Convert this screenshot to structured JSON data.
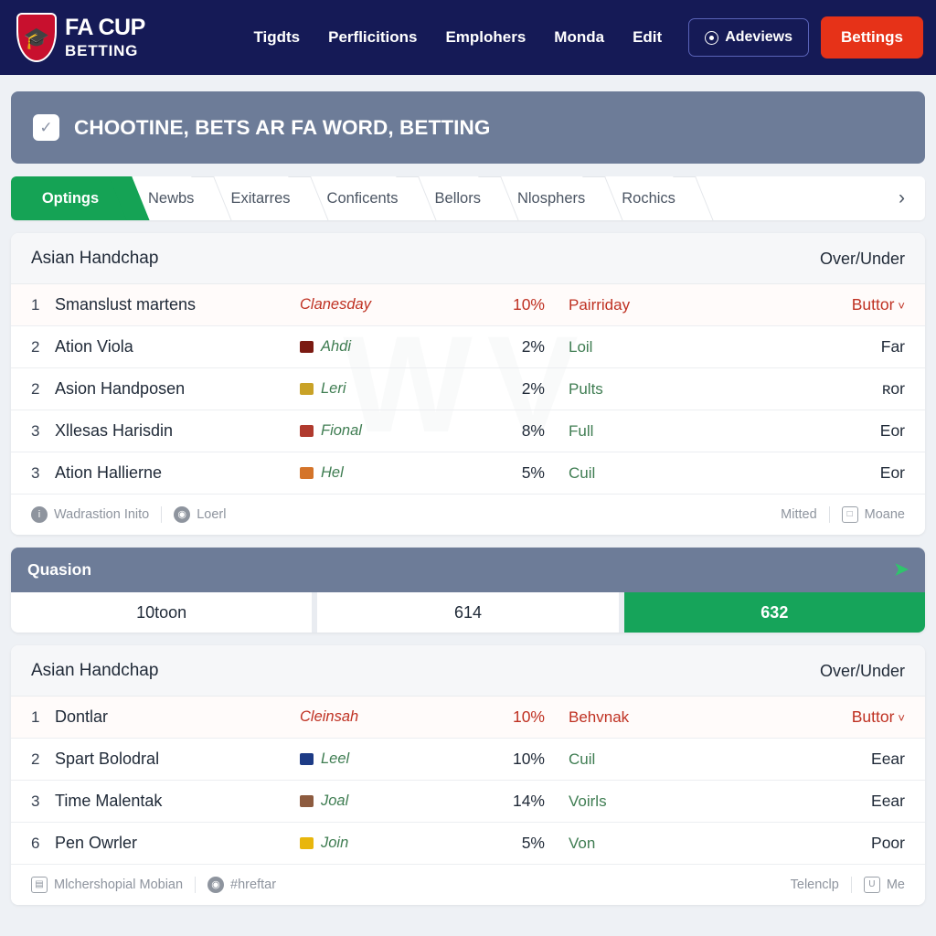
{
  "brand": {
    "line1": "FA CUP",
    "line2": "BETTING",
    "shield_icon": "fa-cup-shield-icon"
  },
  "nav": {
    "links": [
      "Tigdts",
      "Perflicitions",
      "Emplohers",
      "Monda",
      "Edit"
    ],
    "outline_button": {
      "label": "Adeviews",
      "icon": "eye-icon"
    },
    "primary_button": {
      "label": "Bettings",
      "color": "#e63218"
    }
  },
  "banner": {
    "icon": "checkbox-check-icon",
    "title": "CHOOTINE, BETS AR FA WORD, BETTING",
    "color": "#6d7c98"
  },
  "tabs": {
    "items": [
      {
        "label": "Optings",
        "active": true
      },
      {
        "label": "Newbs",
        "active": false
      },
      {
        "label": "Exitarres",
        "active": false
      },
      {
        "label": "Conficents",
        "active": false
      },
      {
        "label": "Bellors",
        "active": false
      },
      {
        "label": "Nlosphers",
        "active": false
      },
      {
        "label": "Rochics",
        "active": false
      }
    ],
    "next_icon": "›",
    "active_color": "#15a355"
  },
  "cards": [
    {
      "watermark": "WV",
      "head_left": "Asian Handchap",
      "head_right": "Over/Under",
      "rows": [
        {
          "rank": "1",
          "name": "Smanslust martens",
          "flag": "",
          "tag": "Clanesday",
          "pct": "10%",
          "mid": "Pairriday",
          "right": "Buttor",
          "caret": "˅",
          "highlight": true
        },
        {
          "rank": "2",
          "name": "Ation Viola",
          "flag": "#7b1a12",
          "tag": "Ahdi",
          "pct": "2%",
          "mid": "Loil",
          "right": "Far",
          "caret": "",
          "highlight": false
        },
        {
          "rank": "2",
          "name": "Asion Handposen",
          "flag": "#c9a227",
          "tag": "Leri",
          "pct": "2%",
          "mid": "Pults",
          "right": "ʀor",
          "caret": "",
          "highlight": false
        },
        {
          "rank": "3",
          "name": "Xllesas Harisdin",
          "flag": "#b03a2e",
          "tag": "Fional",
          "pct": "8%",
          "mid": "Full",
          "right": "Eor",
          "caret": "",
          "highlight": false
        },
        {
          "rank": "3",
          "name": "Ation Hallierne",
          "flag": "#d4742a",
          "tag": "Hel",
          "pct": "5%",
          "mid": "Cuil",
          "right": "Eor",
          "caret": "",
          "highlight": false
        }
      ],
      "footer": {
        "left": [
          {
            "icon": "info-drop-icon",
            "glyph": "i",
            "label": "Wadrastion Inito"
          },
          {
            "icon": "globe-icon",
            "glyph": "◉",
            "label": "Loerl"
          }
        ],
        "right": [
          {
            "icon": "",
            "glyph": "",
            "label": "Mitted"
          },
          {
            "icon": "monitor-icon",
            "glyph": "□",
            "label": "Moane"
          }
        ]
      }
    },
    {
      "watermark": "",
      "head_left": "Asian Handchap",
      "head_right": "Over/Under",
      "rows": [
        {
          "rank": "1",
          "name": "Dontlar",
          "flag": "",
          "tag": "Cleinsah",
          "pct": "10%",
          "mid": "Behvnak",
          "right": "Buttor",
          "caret": "˅",
          "highlight": true
        },
        {
          "rank": "2",
          "name": "Spart Bolodral",
          "flag": "#1d3b86",
          "tag": "Leel",
          "pct": "10%",
          "mid": "Cuil",
          "right": "Eear",
          "caret": "",
          "highlight": false
        },
        {
          "rank": "3",
          "name": "Time Malentak",
          "flag": "#8d5b3f",
          "tag": "Joal",
          "pct": "14%",
          "mid": "Voirls",
          "right": "Eear",
          "caret": "",
          "highlight": false
        },
        {
          "rank": "6",
          "name": "Pen Owrler",
          "flag": "#e8b60c",
          "tag": "Join",
          "pct": "5%",
          "mid": "Von",
          "right": "Poor",
          "caret": "",
          "highlight": false
        }
      ],
      "footer": {
        "left": [
          {
            "icon": "calendar-icon",
            "glyph": "▤",
            "label": "Mlchershopial Mobian"
          },
          {
            "icon": "location-pin-icon",
            "glyph": "◉",
            "label": "#hreftar"
          }
        ],
        "right": [
          {
            "icon": "",
            "glyph": "",
            "label": "Telenclp"
          },
          {
            "icon": "upload-icon",
            "glyph": "U",
            "label": "Me"
          }
        ]
      }
    }
  ],
  "quasion": {
    "title": "Quasion",
    "chevron": "➤",
    "buttons": [
      {
        "label": "10toon",
        "active": false
      },
      {
        "label": "614",
        "active": false
      },
      {
        "label": "632",
        "active": true
      }
    ]
  }
}
